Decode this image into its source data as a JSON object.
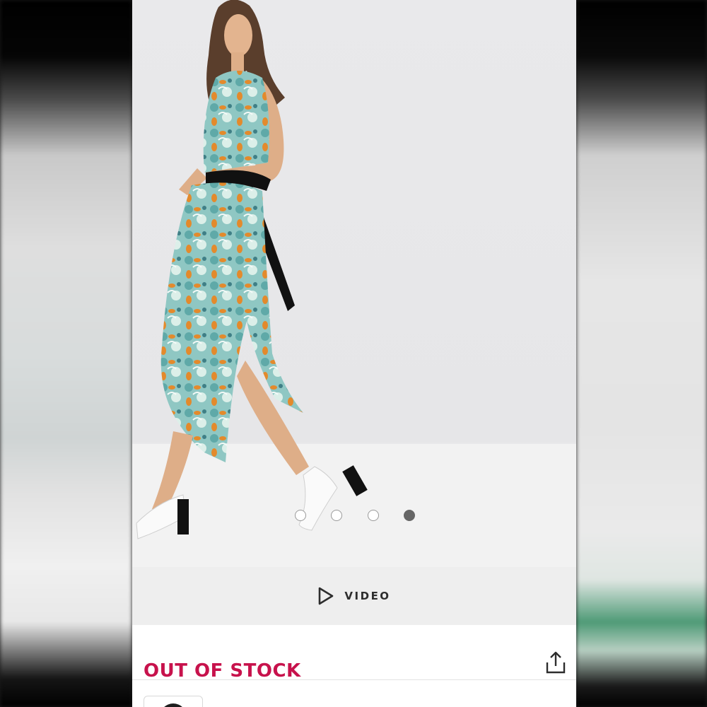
{
  "product": {
    "image_alt": "Model wearing floral lace crop top and midi skirt with black tie belt",
    "carousel": {
      "count": 4,
      "active_index": 3
    },
    "video_label": "VIDEO",
    "stock_status": "OUT OF STOCK"
  },
  "icons": {
    "play": "play-icon",
    "share": "share-icon"
  },
  "colors": {
    "stock_status": "#c7124c",
    "video_bar_bg": "#eeeeee",
    "active_dot": "#666666"
  }
}
